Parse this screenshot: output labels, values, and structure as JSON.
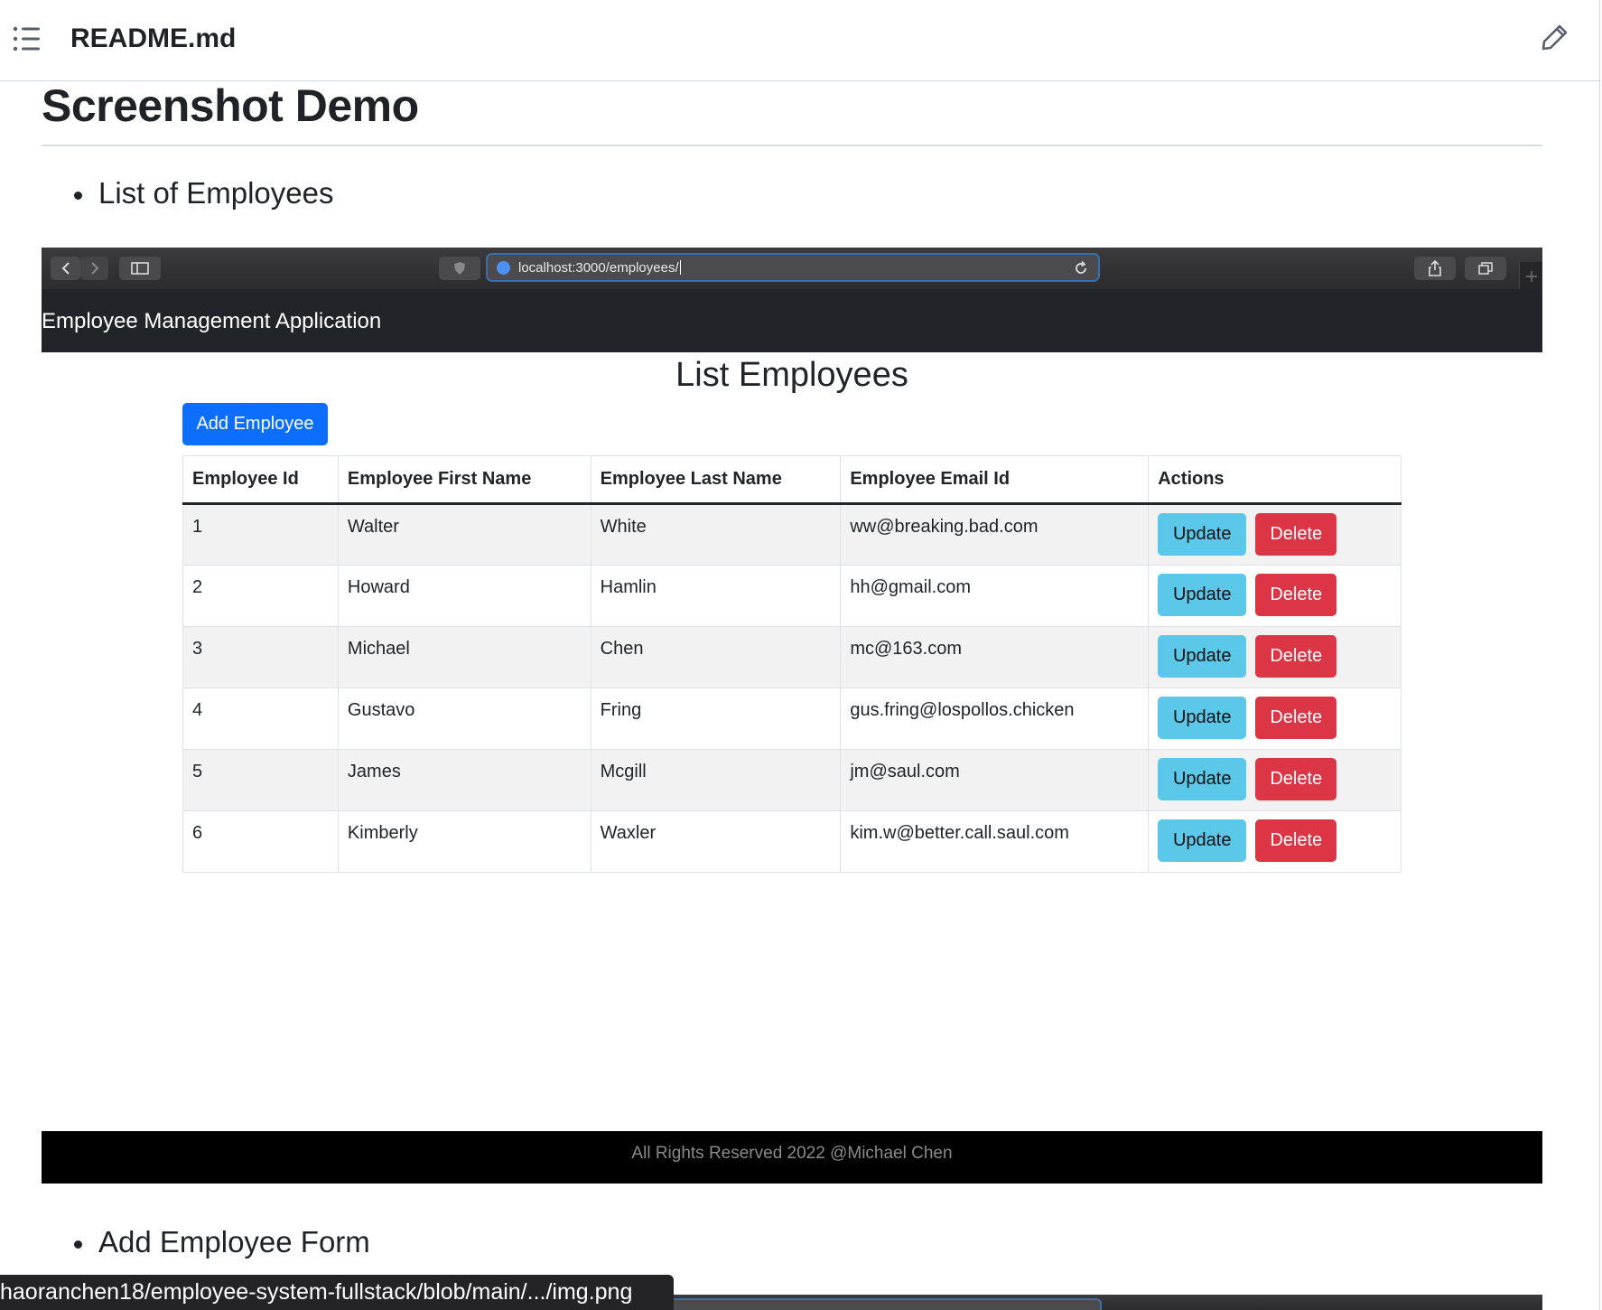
{
  "readme": {
    "filename": "README.md"
  },
  "doc": {
    "title": "Screenshot Demo",
    "bullets": [
      "List of Employees",
      "Add Employee Form"
    ]
  },
  "browser": {
    "url": "localhost:3000/employees/"
  },
  "app": {
    "brand": "Employee Management Application",
    "page_title": "List Employees",
    "add_button": "Add Employee",
    "columns": [
      "Employee Id",
      "Employee First Name",
      "Employee Last Name",
      "Employee Email Id",
      "Actions"
    ],
    "rows": [
      {
        "id": "1",
        "first": "Walter",
        "last": "White",
        "email": "ww@breaking.bad.com"
      },
      {
        "id": "2",
        "first": "Howard",
        "last": "Hamlin",
        "email": "hh@gmail.com"
      },
      {
        "id": "3",
        "first": "Michael",
        "last": "Chen",
        "email": "mc@163.com"
      },
      {
        "id": "4",
        "first": "Gustavo",
        "last": "Fring",
        "email": "gus.fring@lospollos.chicken"
      },
      {
        "id": "5",
        "first": "James",
        "last": "Mcgill",
        "email": "jm@saul.com"
      },
      {
        "id": "6",
        "first": "Kimberly",
        "last": "Waxler",
        "email": "kim.w@better.call.saul.com"
      }
    ],
    "update_label": "Update",
    "delete_label": "Delete",
    "footer": "All Rights Reserved 2022 @Michael Chen"
  },
  "status_bar": {
    "link": "haoranchen18/employee-system-fullstack/blob/main/.../img.png"
  },
  "colors": {
    "primary": "#0d6efd",
    "info": "#5bc8ea",
    "danger": "#dc3545",
    "navbar": "#212529"
  },
  "icons": [
    "list-icon",
    "pencil-icon",
    "back-icon",
    "forward-icon",
    "sidebar-icon",
    "shield-icon",
    "globe-icon",
    "reload-icon",
    "share-icon",
    "tabs-icon",
    "plus-icon"
  ]
}
